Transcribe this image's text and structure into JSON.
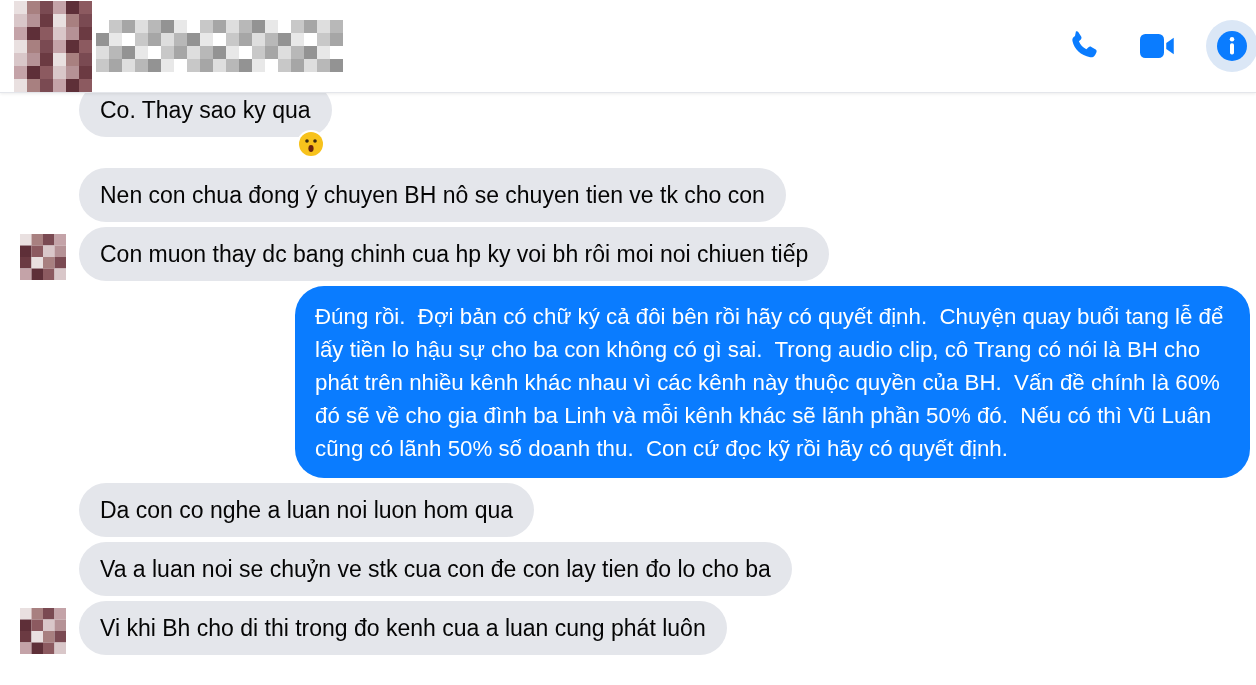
{
  "header": {
    "actions": [
      {
        "kind": "call",
        "selected": false
      },
      {
        "kind": "video",
        "selected": false
      },
      {
        "kind": "info",
        "selected": true
      }
    ]
  },
  "messages": [
    {
      "kind": "incoming",
      "text": "Co. Thay sao ky qua",
      "reaction": {
        "kind": "surprised"
      },
      "avatar": false
    },
    {
      "kind": "incoming",
      "text": "Nen con chua đong ý chuyen BH nô se chuyen tien ve tk cho con",
      "avatar": false
    },
    {
      "kind": "incoming",
      "text": "Con muon thay dc bang chinh cua hp ky voi bh rôi moi noi chiuen tiếp",
      "avatar": true
    },
    {
      "kind": "outgoing",
      "text": "Đúng rồi.  Đợi bản có chữ ký cả đôi bên rồi hãy có quyết định.  Chuyện quay buổi tang lễ để lấy tiền lo hậu sự cho ba con không có gì sai.  Trong audio clip, cô Trang có nói là BH cho phát trên nhiều kênh khác nhau vì các kênh này thuộc quyền của BH.  Vấn đề chính là 60% đó sẽ về cho gia đình ba Linh và mỗi kênh khác sẽ lãnh phần 50% đó.  Nếu có thì Vũ Luân cũng có lãnh 50% số doanh thu.  Con cứ đọc kỹ rồi hãy có quyết định.",
      "avatar": false
    },
    {
      "kind": "incoming",
      "text": "Da con co nghe a luan noi luon hom qua",
      "avatar": false
    },
    {
      "kind": "incoming",
      "text": "Va a luan noi se chuỷn ve stk cua con đe con lay tien đo lo cho ba",
      "avatar": false
    },
    {
      "kind": "incoming",
      "text": "Vi khi Bh cho di thi trong đo kenh cua a luan cung phát luôn",
      "avatar": true
    }
  ]
}
